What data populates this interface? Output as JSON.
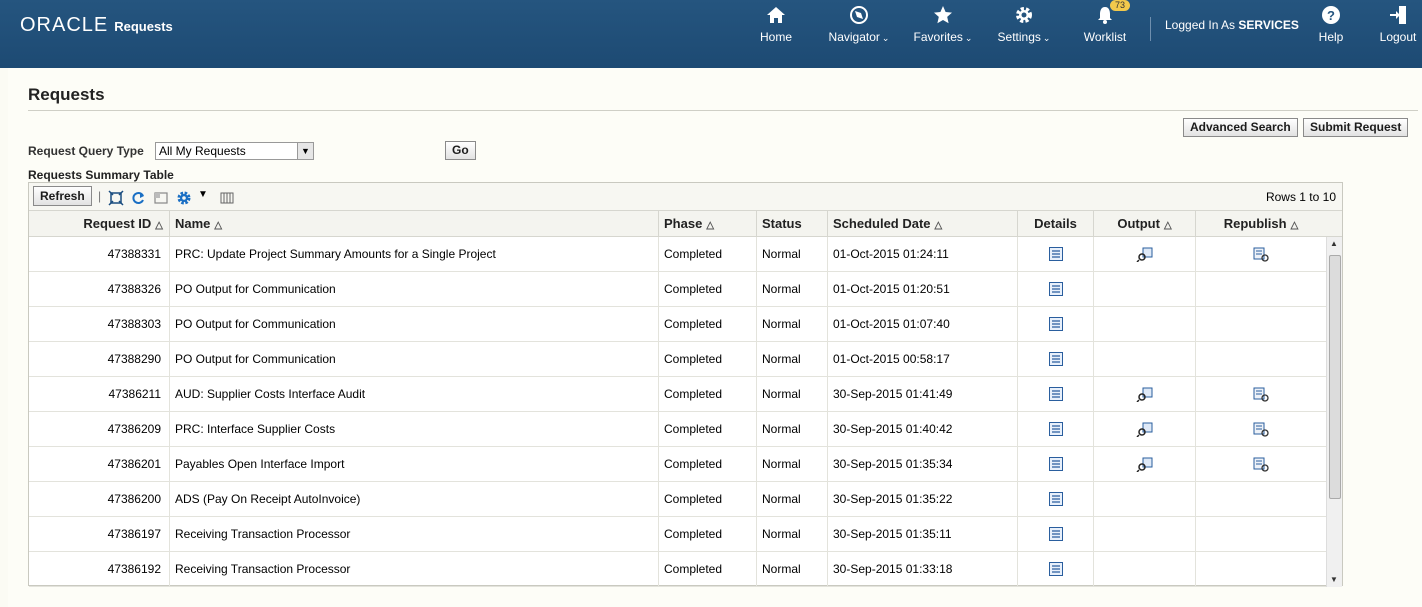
{
  "header": {
    "logo": "ORACLE",
    "app_name": "Requests",
    "nav": {
      "home": "Home",
      "navigator": "Navigator",
      "favorites": "Favorites",
      "settings": "Settings",
      "worklist": "Worklist",
      "worklist_badge": "73",
      "help": "Help",
      "logout": "Logout"
    },
    "logged_in_prefix": "Logged In As",
    "logged_in_user": "SERVICES"
  },
  "page": {
    "title": "Requests",
    "advanced_search": "Advanced Search",
    "submit_request": "Submit Request",
    "query_type_label": "Request Query Type",
    "query_type_value": "All My Requests",
    "go": "Go",
    "summary_label": "Requests Summary Table",
    "refresh": "Refresh",
    "rows_info": "Rows 1 to 10"
  },
  "table": {
    "columns": [
      "Request ID",
      "Name",
      "Phase",
      "Status",
      "Scheduled Date",
      "Details",
      "Output",
      "Republish"
    ],
    "rows": [
      {
        "id": "47388331",
        "name": "PRC: Update Project Summary Amounts for a Single Project",
        "phase": "Completed",
        "status": "Normal",
        "date": "01-Oct-2015 01:24:11",
        "output": true,
        "republish": true
      },
      {
        "id": "47388326",
        "name": "PO Output for Communication",
        "phase": "Completed",
        "status": "Normal",
        "date": "01-Oct-2015 01:20:51",
        "output": false,
        "republish": false
      },
      {
        "id": "47388303",
        "name": "PO Output for Communication",
        "phase": "Completed",
        "status": "Normal",
        "date": "01-Oct-2015 01:07:40",
        "output": false,
        "republish": false
      },
      {
        "id": "47388290",
        "name": "PO Output for Communication",
        "phase": "Completed",
        "status": "Normal",
        "date": "01-Oct-2015 00:58:17",
        "output": false,
        "republish": false
      },
      {
        "id": "47386211",
        "name": "AUD: Supplier Costs Interface Audit",
        "phase": "Completed",
        "status": "Normal",
        "date": "30-Sep-2015 01:41:49",
        "output": true,
        "republish": true
      },
      {
        "id": "47386209",
        "name": "PRC: Interface Supplier Costs",
        "phase": "Completed",
        "status": "Normal",
        "date": "30-Sep-2015 01:40:42",
        "output": true,
        "republish": true
      },
      {
        "id": "47386201",
        "name": "Payables Open Interface Import",
        "phase": "Completed",
        "status": "Normal",
        "date": "30-Sep-2015 01:35:34",
        "output": true,
        "republish": true
      },
      {
        "id": "47386200",
        "name": "ADS (Pay On Receipt AutoInvoice)",
        "phase": "Completed",
        "status": "Normal",
        "date": "30-Sep-2015 01:35:22",
        "output": false,
        "republish": false
      },
      {
        "id": "47386197",
        "name": "Receiving Transaction Processor",
        "phase": "Completed",
        "status": "Normal",
        "date": "30-Sep-2015 01:35:11",
        "output": false,
        "republish": false
      },
      {
        "id": "47386192",
        "name": "Receiving Transaction Processor",
        "phase": "Completed",
        "status": "Normal",
        "date": "30-Sep-2015 01:33:18",
        "output": false,
        "republish": false
      }
    ]
  }
}
